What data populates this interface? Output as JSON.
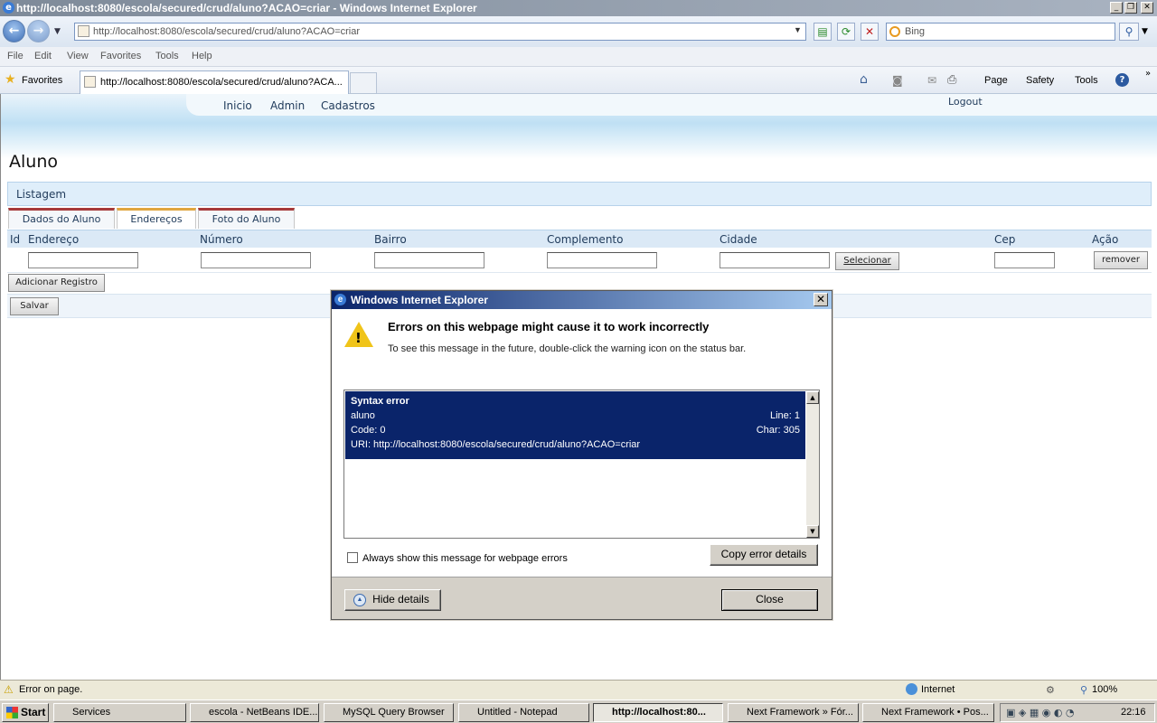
{
  "window": {
    "title": "http://localhost:8080/escola/secured/crud/aluno?ACAO=criar - Windows Internet Explorer"
  },
  "address": {
    "url": "http://localhost:8080/escola/secured/crud/aluno?ACAO=criar"
  },
  "search": {
    "placeholder": "Bing"
  },
  "menu": [
    "File",
    "Edit",
    "View",
    "Favorites",
    "Tools",
    "Help"
  ],
  "favorites": {
    "label": "Favorites"
  },
  "tab": {
    "title": "http://localhost:8080/escola/secured/crud/aluno?ACA..."
  },
  "commands": {
    "page": "Page",
    "safety": "Safety",
    "tools": "Tools"
  },
  "site": {
    "nav": [
      "Inicio",
      "Admin",
      "Cadastros"
    ],
    "logout": "Logout",
    "heading": "Aluno",
    "section": "Listagem",
    "tabs": [
      "Dados do Aluno",
      "Endereços",
      "Foto do Aluno"
    ],
    "columns": [
      "Id",
      "Endereço",
      "Número",
      "Bairro",
      "Complemento",
      "Cidade",
      "Cep",
      "Ação"
    ],
    "select_btn": "Selecionar",
    "remove_btn": "remover",
    "add_btn": "Adicionar Registro",
    "save_btn": "Salvar"
  },
  "dialog": {
    "title": "Windows Internet Explorer",
    "message": "Errors on this webpage might cause it to work incorrectly",
    "submessage": "To see this message in the future, double-click the warning icon on the status bar.",
    "error": {
      "name": "Syntax error",
      "file": "aluno",
      "line": "Line: 1",
      "code": "Code: 0",
      "char": "Char: 305",
      "uri": "URI: http://localhost:8080/escola/secured/crud/aluno?ACAO=criar"
    },
    "checkbox_label": "Always show this message for webpage errors",
    "copy_btn": "Copy error details",
    "hide_btn": "Hide details",
    "close_btn": "Close"
  },
  "statusbar": {
    "message": "Error on page.",
    "zone": "Internet",
    "zoom": "100%"
  },
  "taskbar": {
    "start": "Start",
    "items": [
      "Services",
      "escola - NetBeans IDE...",
      "MySQL Query Browser",
      "Untitled - Notepad",
      "http://localhost:80...",
      "Next Framework » Fór...",
      "Next Framework • Pos..."
    ],
    "clock": "22:16"
  }
}
